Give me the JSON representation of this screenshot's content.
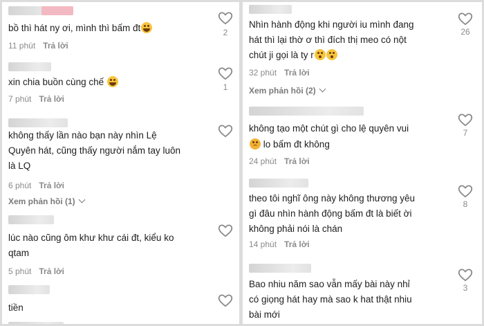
{
  "left": {
    "comments": [
      {
        "text": "bồ thì hát ny ơi, mình thì bấm đt",
        "emoji": "laugh",
        "time": "11 phút",
        "reply": "Trả lời",
        "likes": "2"
      },
      {
        "text": "xin chia buồn cùng chế",
        "emoji": "laugh",
        "time": "7 phút",
        "reply": "Trả lời",
        "likes": "1"
      },
      {
        "text": "không thấy lần nào bạn này nhìn Lệ\nQuyên hát, cũng thấy người nắm tay luôn\nlà LQ",
        "time": "6 phút",
        "reply": "Trả lời",
        "likes": "",
        "view_replies": "Xem phản hồi (1)"
      },
      {
        "text": "lúc nào cũng ôm khư khư cái đt, kiểu ko\nqtam",
        "time": "5 phút",
        "reply": "Trả lời",
        "likes": ""
      },
      {
        "text": "tiền",
        "likes": ""
      }
    ]
  },
  "right": {
    "comments": [
      {
        "text": "Nhìn hành động khi người iu mình đang\nhát thì lại thờ ơ thì đích thị meo có nột\nchút ji gọi là ty r",
        "emoji": "flush",
        "time": "32 phút",
        "reply": "Trả lời",
        "likes": "26",
        "view_replies": "Xem phản hồi (2)"
      },
      {
        "text": "không tạo một chút gì cho lệ quyên vui",
        "text2": "lo bấm đt không",
        "emoji": "plead",
        "time": "24 phút",
        "reply": "Trả lời",
        "likes": "7"
      },
      {
        "text": "theo tôi nghĩ ông này không thương yêu\ngì đâu nhìn hành động bấm đt là biết ời\nkhông phải nói là chán",
        "time": "14 phút",
        "reply": "Trả lời",
        "likes": "8"
      },
      {
        "text": "Bao nhiu năm sao vẫn mấy bài này nhỉ\ncó giọng hát hay mà sao k hat thật nhiu\nbài mới",
        "likes": "3"
      }
    ]
  },
  "colors": {
    "text": "#1d1d1d",
    "meta": "#8a8a8a",
    "heart": "#8a8a8a",
    "emoji": "#f7c53c"
  }
}
